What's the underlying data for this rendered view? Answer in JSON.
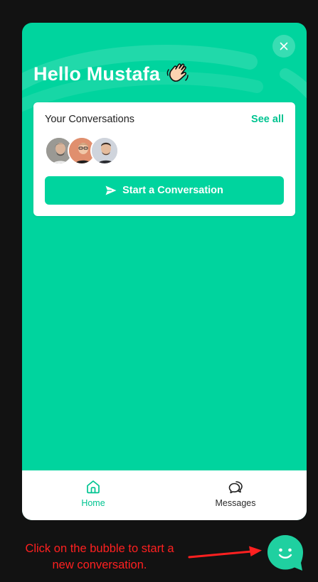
{
  "header": {
    "greeting": "Hello Mustafa",
    "wave_icon": "waving-hand-emoji",
    "close_icon": "close-icon"
  },
  "conversations_card": {
    "title": "Your Conversations",
    "see_all_label": "See all",
    "avatars": [
      "team-member-1",
      "team-member-2",
      "team-member-3"
    ],
    "start_button_label": "Start a Conversation",
    "start_button_icon": "send-icon"
  },
  "bottom_nav": {
    "items": [
      {
        "label": "Home",
        "icon": "home-icon",
        "active": true
      },
      {
        "label": "Messages",
        "icon": "chat-bubbles-icon",
        "active": false
      }
    ]
  },
  "annotation": {
    "text": "Click on the bubble to start a new conversation.",
    "color": "#ff2020"
  },
  "launcher": {
    "icon": "smiley-chat-bubble-icon"
  },
  "theme": {
    "accent": "#00d49e",
    "accent_text": "#00c491",
    "background": "#121212"
  }
}
